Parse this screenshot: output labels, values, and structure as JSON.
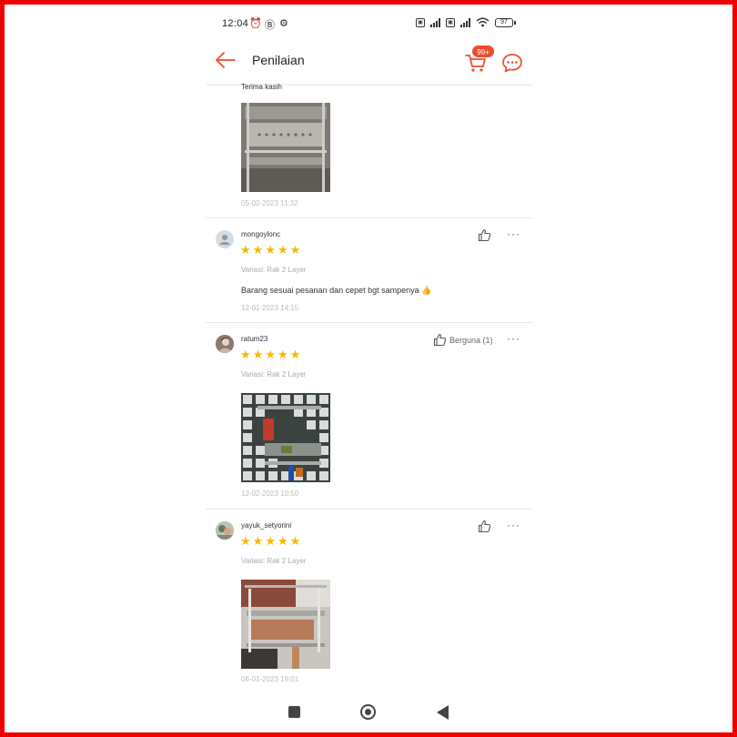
{
  "status_bar": {
    "time": "12:04",
    "icons": [
      "alarm-icon",
      "gear-icon",
      "sim-icon",
      "signal-icon",
      "wifi-icon"
    ],
    "battery": "97"
  },
  "header": {
    "title": "Penilaian",
    "cart_badge": "99+",
    "icons": [
      "back-arrow-icon",
      "cart-icon",
      "chat-icon"
    ]
  },
  "reviews": [
    {
      "text": "Terima kasih",
      "date": "05-02-2023 11:32",
      "has_photo": true
    },
    {
      "username": "mongoylonc",
      "rating": 5,
      "variant": "Variasi: Rak 2 Layer",
      "text": "Barang sesuai pesanan dan cepet bgt sampenya 👍",
      "date": "12-01-2023 14:15",
      "like_label": ""
    },
    {
      "username": "ratum23",
      "rating": 5,
      "variant": "Variasi: Rak 2 Layer",
      "date": "12-02-2023 10:50",
      "like_label": "Berguna (1)",
      "has_photo": true
    },
    {
      "username": "yayuk_setyorini",
      "rating": 5,
      "variant": "Variasi: Rak 2 Layer",
      "date": "06-01-2023 19:01",
      "like_label": "",
      "has_photo": true
    }
  ],
  "nav": {
    "icons": [
      "recent-apps-icon",
      "home-icon",
      "back-icon"
    ]
  },
  "colors": {
    "accent": "#ee4d2d",
    "star": "#f6b800",
    "frame": "#ee0000"
  }
}
